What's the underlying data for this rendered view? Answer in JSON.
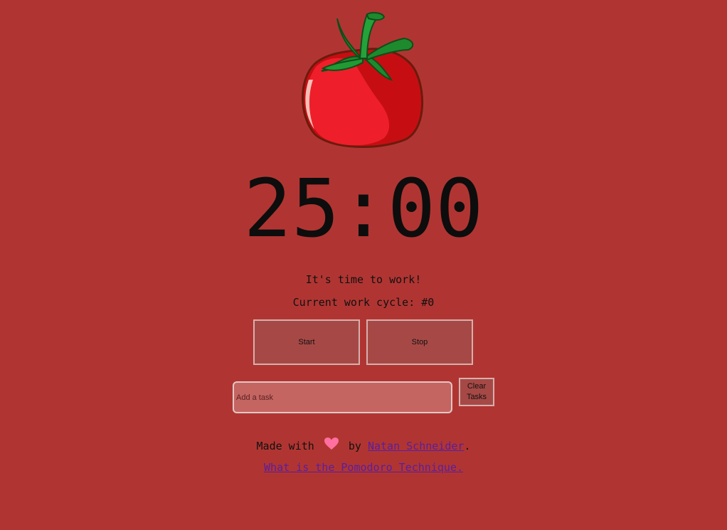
{
  "colors": {
    "background": "#b03532",
    "button_bg": "#a64946",
    "input_bg": "#c46562",
    "link": "#5a1ea0",
    "heart": "#ff6f9f"
  },
  "logo": {
    "icon": "tomato-icon"
  },
  "timer": {
    "display": "25:00"
  },
  "status": {
    "message": "It's time to work!",
    "cycle": "Current work cycle: #0"
  },
  "controls": {
    "start_label": "Start",
    "stop_label": "Stop"
  },
  "tasks": {
    "input_value": "",
    "input_placeholder": "Add a task",
    "clear_label_line1": "Clear",
    "clear_label_line2": "Tasks"
  },
  "footer": {
    "made_with": "Made with",
    "heart_icon": "heart-icon",
    "by": "by",
    "author": "Natan Schneider",
    "period": ".",
    "technique_link": "What is the Pomodoro Technique."
  }
}
